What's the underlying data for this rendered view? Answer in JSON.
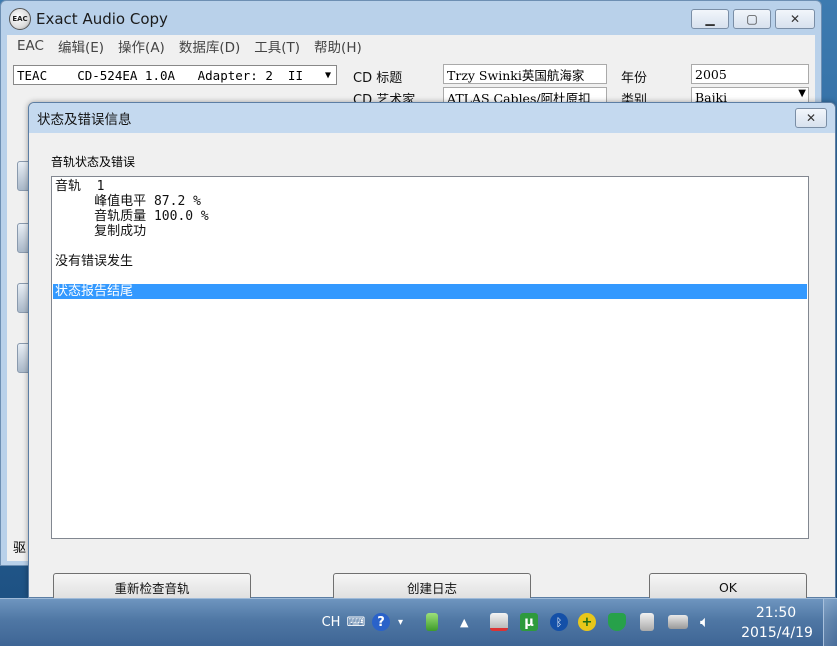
{
  "main_window": {
    "title": "Exact Audio Copy",
    "logo_text": "EAC",
    "menu": [
      "EAC",
      "编辑(E)",
      "操作(A)",
      "数据库(D)",
      "工具(T)",
      "帮助(H)"
    ],
    "drive": "TEAC    CD-524EA 1.0A   Adapter: 2  II",
    "labels": {
      "cd_title": "CD  标题",
      "cd_artist": "CD  艺术家",
      "year": "年份",
      "genre": "类别",
      "drive_short": "驱"
    },
    "fields": {
      "cd_title": "Trzy Swinki英国航海家",
      "cd_artist": "ATLAS Cables/阿杜原扣",
      "year": "2005",
      "genre": "Bajki"
    }
  },
  "dialog": {
    "title": "状态及错误信息",
    "group_label": "音轨状态及错误",
    "lines": [
      "音轨  1",
      "     峰值电平 87.2 %",
      "     音轨质量 100.0 %",
      "     复制成功",
      "没有错误发生",
      "状态报告结尾"
    ],
    "buttons": {
      "recheck": "重新检查音轨",
      "create_log": "创建日志",
      "ok": "OK"
    }
  },
  "taskbar": {
    "input_lang": "CH",
    "time": "21:50",
    "date": "2015/4/19"
  },
  "icons": {
    "minimize": "minimize-icon",
    "maximize": "maximize-icon",
    "close": "close-icon"
  }
}
